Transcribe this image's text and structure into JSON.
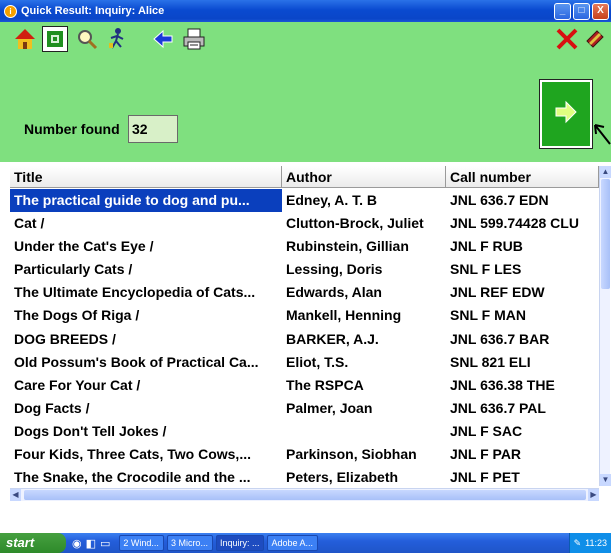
{
  "window": {
    "title": "Quick Result: Inquiry: Alice",
    "minimize_label": "_",
    "maximize_label": "□",
    "close_label": "X"
  },
  "colors": {
    "titlebar": "#0a46c8",
    "panel_green": "#7fe07f",
    "button_green": "#1fa51f",
    "selection": "#0a3fbd"
  },
  "toolbar": {
    "icons": [
      "home-icon",
      "catalog-icon",
      "magnifier-icon",
      "walking-person-icon",
      "back-arrow-icon",
      "printer-icon",
      "close-x-icon",
      "book-exit-icon"
    ]
  },
  "results": {
    "found_label": "Number found",
    "found_value": "32"
  },
  "table": {
    "columns": [
      "Title",
      "Author",
      "Call number"
    ],
    "rows": [
      {
        "title": "The practical guide to dog and pu...",
        "author": "Edney, A. T. B",
        "call": "JNL 636.7 EDN",
        "selected": true
      },
      {
        "title": "Cat /",
        "author": "Clutton-Brock, Juliet",
        "call": "JNL 599.74428 CLU"
      },
      {
        "title": "Under the Cat's Eye /",
        "author": "Rubinstein, Gillian",
        "call": "JNL F RUB"
      },
      {
        "title": "Particularly Cats /",
        "author": "Lessing, Doris",
        "call": "SNL F LES"
      },
      {
        "title": "The Ultimate Encyclopedia of Cats...",
        "author": "Edwards, Alan",
        "call": "JNL REF EDW"
      },
      {
        "title": "The Dogs Of Riga /",
        "author": "Mankell, Henning",
        "call": "SNL F MAN"
      },
      {
        "title": "DOG BREEDS /",
        "author": "BARKER, A.J.",
        "call": "JNL 636.7 BAR"
      },
      {
        "title": "Old Possum's Book of Practical Ca...",
        "author": "Eliot, T.S.",
        "call": "SNL 821 ELI"
      },
      {
        "title": "Care For Your Cat /",
        "author": "The RSPCA",
        "call": "JNL 636.38 THE"
      },
      {
        "title": "Dog Facts /",
        "author": "Palmer, Joan",
        "call": "JNL 636.7 PAL"
      },
      {
        "title": "Dogs Don't Tell Jokes /",
        "author": "",
        "call": "JNL F SAC"
      },
      {
        "title": "Four Kids, Three Cats, Two Cows,...",
        "author": "Parkinson, Siobhan",
        "call": "JNL F PAR"
      },
      {
        "title": "The Snake, the Crocodile and the ...",
        "author": "Peters, Elizabeth",
        "call": "JNL F PET"
      }
    ]
  },
  "taskbar": {
    "start": "start",
    "tasks": [
      "2 Wind...",
      "3 Micro...",
      "Inquiry: ...",
      "Adobe A..."
    ],
    "clock": "11:23"
  }
}
